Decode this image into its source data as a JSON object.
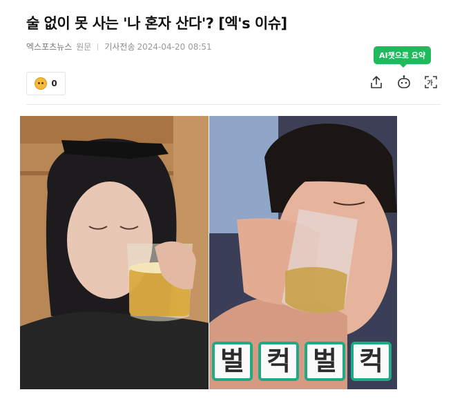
{
  "article": {
    "title": "술 없이 못 사는 '나 혼자 산다'? [엑's 이슈]",
    "press": "엑스포츠뉴스",
    "original_link": "원문",
    "timestamp_label": "기사전송",
    "timestamp": "2024-04-20 08:51"
  },
  "ai_summary": {
    "label": "AI챗으로 요약"
  },
  "reaction": {
    "icon": "emoji-face-icon",
    "count": "0"
  },
  "toolbar": {
    "icons": [
      "share-icon",
      "ai-bot-icon",
      "font-size-icon"
    ]
  },
  "images": [
    {
      "name": "photo-woman-drinking-beer"
    },
    {
      "name": "photo-man-drinking-beer",
      "caption": [
        "벌",
        "컥",
        "벌",
        "컥"
      ]
    }
  ],
  "colors": {
    "accent_green": "#1fba5d",
    "caption_border": "#21a884"
  }
}
